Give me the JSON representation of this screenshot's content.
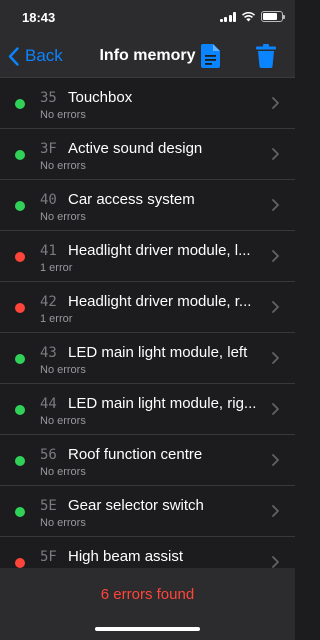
{
  "status_bar": {
    "time": "18:43"
  },
  "nav": {
    "back_label": "Back",
    "title": "Info memory",
    "doc_icon": "document-icon",
    "trash_icon": "trash-icon"
  },
  "colors": {
    "ok": "#30d158",
    "error": "#ff453a",
    "accent": "#0a84ff"
  },
  "modules": [
    {
      "code": "35",
      "name": "Touchbox",
      "status": "No errors",
      "state": "ok"
    },
    {
      "code": "3F",
      "name": "Active sound design",
      "status": "No errors",
      "state": "ok"
    },
    {
      "code": "40",
      "name": "Car access system",
      "status": "No errors",
      "state": "ok"
    },
    {
      "code": "41",
      "name": "Headlight driver module, l...",
      "status": "1 error",
      "state": "error"
    },
    {
      "code": "42",
      "name": "Headlight driver module, r...",
      "status": "1 error",
      "state": "error"
    },
    {
      "code": "43",
      "name": "LED main light module, left",
      "status": "No errors",
      "state": "ok"
    },
    {
      "code": "44",
      "name": "LED main light module, rig...",
      "status": "No errors",
      "state": "ok"
    },
    {
      "code": "56",
      "name": "Roof function centre",
      "status": "No errors",
      "state": "ok"
    },
    {
      "code": "5E",
      "name": "Gear selector switch",
      "status": "No errors",
      "state": "ok"
    },
    {
      "code": "5F",
      "name": "High beam assist",
      "status": "",
      "state": "error"
    }
  ],
  "footer": {
    "summary": "6 errors found"
  }
}
